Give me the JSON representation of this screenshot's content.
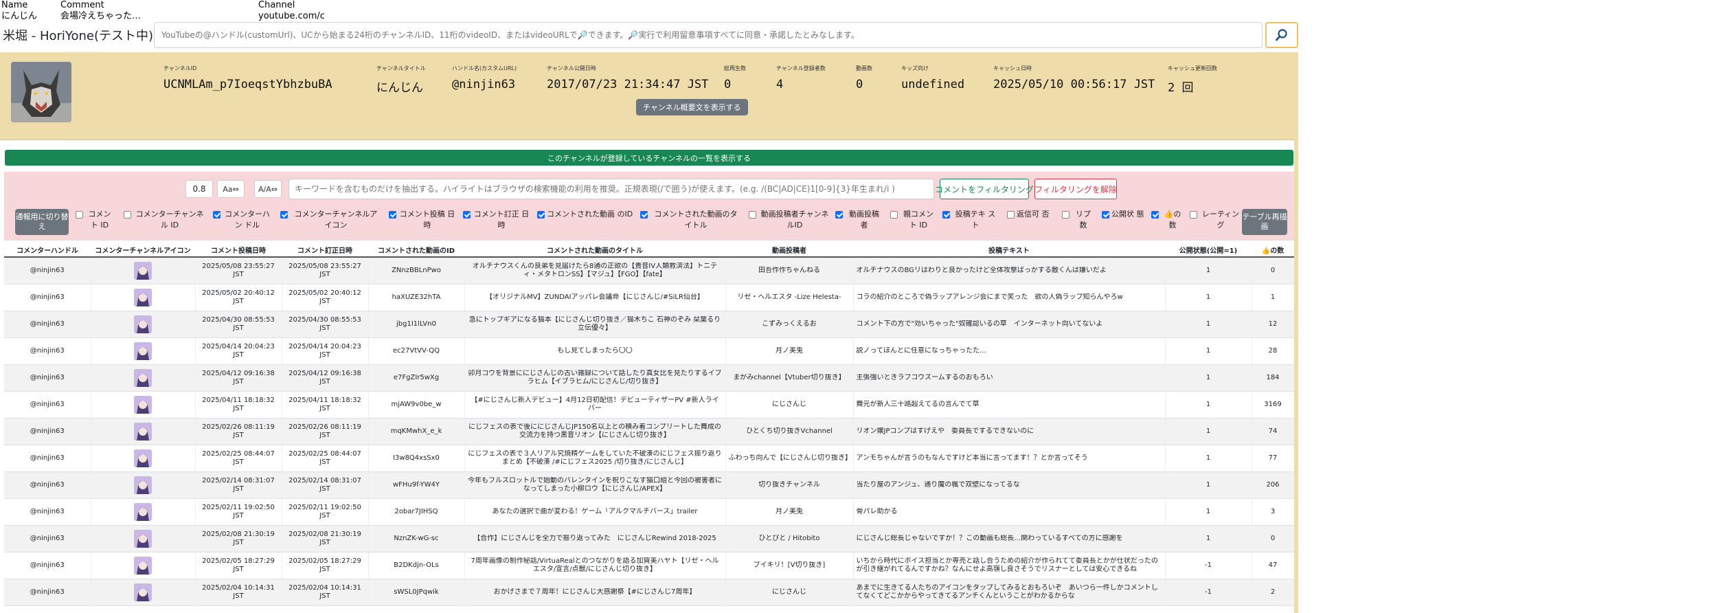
{
  "header_cols": [
    {
      "label": "Name",
      "value": "にんじん"
    },
    {
      "label": "Comment",
      "value": "会場冷えちゃった…"
    },
    {
      "label": "Channel",
      "value": "youtube.com/c"
    }
  ],
  "app_title": "米堀 - HoriYone(テスト中)",
  "search": {
    "placeholder": "YouTubeの@ハンドル(customUrl)、UCから始まる24桁のチャンネルID、11桁のvideoID、またはvideoURLで🔎できます。🔎実行で利用留意事項すべてに同意・承諾したとみなします。"
  },
  "channel": {
    "fields": [
      {
        "label": "チャンネルID",
        "value": "UCNMLAm_p7IoeqstYbhzbuBA"
      },
      {
        "label": "チャンネルタイトル",
        "value": "にんじん"
      },
      {
        "label": "ハンドル名(カスタムURL)",
        "value": "@ninjin63"
      },
      {
        "label": "チャンネル公開日時",
        "value": "2017/07/23 21:34:47 JST"
      },
      {
        "label": "総再生数",
        "value": "0"
      },
      {
        "label": "チャンネル登録者数",
        "value": "4"
      },
      {
        "label": "動画数",
        "value": "0"
      },
      {
        "label": "キッズ向け",
        "value": "undefined"
      },
      {
        "label": "キャッシュ日時",
        "value": "2025/05/10 00:56:17 JST"
      },
      {
        "label": "キャッシュ更新回数",
        "value": "2 回"
      }
    ],
    "summary_button": "チャンネル概要文を表示する"
  },
  "registered_channels_bar": "このチャンネルが登録しているチャンネルの一覧を表示する",
  "filter": {
    "threshold": "0.8",
    "btn_case": "Aa⇔",
    "btn_width": "A/A⇔",
    "placeholder": "キーワードを含むものだけを抽出する。ハイライトはブラウザの検索機能の利用を推奨。正規表現(/で囲う)が使えます。(e.g. /(BC|AD|CE)1[0-9]{3}年生まれ/i )",
    "apply_button": "コメントをフィルタリング",
    "clear_button": "フィルタリングを解除"
  },
  "toggle_button": "通報用に切り替え",
  "redraw_button": "テーブル再描画",
  "columns_checks": [
    {
      "label": "コメント ID",
      "checked": false
    },
    {
      "label": "コメンターチャンネル ID",
      "checked": false
    },
    {
      "label": "コメンターハン ドル",
      "checked": true
    },
    {
      "label": "コメンターチャンネルア イコン",
      "checked": true
    },
    {
      "label": "コメント投稿 日時",
      "checked": true
    },
    {
      "label": "コメント訂正 日時",
      "checked": true
    },
    {
      "label": "コメントされた動画 のID",
      "checked": true
    },
    {
      "label": "コメントされた動画のタ イトル",
      "checked": true
    },
    {
      "label": "動画投稿者チャンネ ルID",
      "checked": false
    },
    {
      "label": "動画投稿 者",
      "checked": true
    },
    {
      "label": "親コメント ID",
      "checked": false
    },
    {
      "label": "投稿テキ スト",
      "checked": true
    },
    {
      "label": "返信可 否",
      "checked": false
    },
    {
      "label": "リプ 数",
      "checked": false
    },
    {
      "label": "公開状 態",
      "checked": true
    },
    {
      "label": "👍の 数",
      "checked": true
    },
    {
      "label": "レーティン グ",
      "checked": false
    }
  ],
  "table": {
    "headers": [
      "コメンターハンドル",
      "コメンターチャンネルアイコン",
      "コメント投稿日時",
      "コメント訂正日時",
      "コメントされた動画のID",
      "コメントされた動画のタイトル",
      "動画投稿者",
      "投稿テキスト",
      "公開状態(公開=1)",
      "👍の数"
    ],
    "rows": [
      {
        "handle": "@ninjin63",
        "posted": "2025/05/08 23:55:27 JST",
        "edited": "2025/05/08 23:55:27 JST",
        "vid": "ZNnzBBLnPwo",
        "title": "オルチナウスくんの良弟を見届けたら8通の正欲の【貴音IV人類救済法】トニティ・メタトロンSS】【マジュ】【FGO】【fate】",
        "uploader": "田吾作作ちゃんねる",
        "text": "オルチナウスのBGリはわりと良かったけど全体攻撃ばっかする敵くんは嫌いだよ",
        "public": "1",
        "likes": "0"
      },
      {
        "handle": "@ninjin63",
        "posted": "2025/05/02 20:40:12 JST",
        "edited": "2025/05/02 20:40:12 JST",
        "vid": "haXUZE32hTA",
        "title": "【オリジナルMV】ZUNDAIアッパレ会議命【にじさんじ/#SiLR仙台】",
        "uploader": "リゼ・ヘルエスタ -Lize Helesta-",
        "text": "コラの紹介のところで偽ラップアレンジ会にまで笑った　欲の人偽ラップ知らんやろw",
        "public": "1",
        "likes": "1"
      },
      {
        "handle": "@ninjin63",
        "posted": "2025/04/30 08:55:53 JST",
        "edited": "2025/04/30 08:55:53 JST",
        "vid": "jbg1I1lLVn0",
        "title": "急にトップギアになる猫本【にじさんじ切り抜き／猫木ちこ 石神のぞみ 栞葉るり 立伝優々】",
        "uploader": "こずみっくえるお",
        "text": "コメント下の方で\"効いちゃった\"奴確認いるの草　インターネット向いてないよ",
        "public": "1",
        "likes": "12"
      },
      {
        "handle": "@ninjin63",
        "posted": "2025/04/14 20:04:23 JST",
        "edited": "2025/04/14 20:04:23 JST",
        "vid": "ec27VtVV-QQ",
        "title": "もし見てしまったら〇〇",
        "uploader": "月ノ美兎",
        "text": "説ノってほんとに任意になっちゃったた…",
        "public": "1",
        "likes": "28"
      },
      {
        "handle": "@ninjin63",
        "posted": "2025/04/12 09:16:38 JST",
        "edited": "2025/04/12 09:16:38 JST",
        "vid": "e7FgZIr5wXg",
        "title": "卯月コウを背景ににじさんじの古い雑録について話したり真女比を見たりするイブラヒム【イブラヒム/にじさんじ/切り抜き】",
        "uploader": "まがみchannel【Vtuber切り抜き】",
        "text": "主張強いときラブコウズームするのおもろい",
        "public": "1",
        "likes": "184"
      },
      {
        "handle": "@ninjin63",
        "posted": "2025/04/11 18:18:32 JST",
        "edited": "2025/04/11 18:18:32 JST",
        "vid": "mjAW9v0be_w",
        "title": "【#にじさんじ新人デビュー】4月12日初配信！デビューティザーPV #新人ライバー",
        "uploader": "にじさんじ",
        "text": "舞元が新人三十路超えてるの言んでて草",
        "public": "1",
        "likes": "3169"
      },
      {
        "handle": "@ninjin63",
        "posted": "2025/02/26 08:11:19 JST",
        "edited": "2025/02/26 08:11:19 JST",
        "vid": "mqKMwhX_e_k",
        "title": "にじフェスの表で後ににじさんじJP150名以上との積み着コンプリートした舞成の交流力を持つ黒音リオン【にじさんじ切り抜き】",
        "uploader": "ひとくち切り抜きVchannel",
        "text": "リオン嬢JPコンプはすげえや　委員長でするできないのに",
        "public": "1",
        "likes": "74"
      },
      {
        "handle": "@ninjin63",
        "posted": "2025/02/25 08:44:07 JST",
        "edited": "2025/02/25 08:44:07 JST",
        "vid": "I3w8Q4xsSx0",
        "title": "にじフェスの表で３人リアル究焼精ゲームをしていた不破湊のにじフェス振り返りまとめ【不破湊 /#にじフェス2025 /切り抜き/にじさんじ】",
        "uploader": "ふわっち向んで【にじさんじ切り抜き】",
        "text": "アンモちゃんが言うのもなんですけど本当に言ってます！？とか言ってそう",
        "public": "1",
        "likes": "77"
      },
      {
        "handle": "@ninjin63",
        "posted": "2025/02/14 08:31:07 JST",
        "edited": "2025/02/14 08:31:07 JST",
        "vid": "wFHu9f-YW4Y",
        "title": "今年もフルスロットルで始動のバレンタインを祝りこなす猫口組と今回の被害者になってしまった小柳ロウ【にじさんじ/APEX】",
        "uploader": "切り抜きチャンネル",
        "text": "当たり屋のアンジュ、通り魔の楓で双壁になってるな",
        "public": "1",
        "likes": "206"
      },
      {
        "handle": "@ninjin63",
        "posted": "2025/02/11 19:02:50 JST",
        "edited": "2025/02/11 19:02:50 JST",
        "vid": "2obar7JIHSQ",
        "title": "あなたの選択で曲が変わる！ゲーム「アルクマルチバース」trailer",
        "uploader": "月ノ美兎",
        "text": "骨パレ助かる",
        "public": "1",
        "likes": "3"
      },
      {
        "handle": "@ninjin63",
        "posted": "2025/02/08 21:30:19 JST",
        "edited": "2025/02/08 21:30:19 JST",
        "vid": "NznZK-wG-sc",
        "title": "【合作】にじさんじを全力で振り返ってみた　にじさんじRewind 2018-2025",
        "uploader": "ひとぴと / Hitobito",
        "text": "にじさんじ総長じゃないですか！？この動画も総長…関わっているすべての方に感謝を",
        "public": "1",
        "likes": "0"
      },
      {
        "handle": "@ninjin63",
        "posted": "2025/02/05 18:27:29 JST",
        "edited": "2025/02/05 18:27:29 JST",
        "vid": "B2DKdjn-OLs",
        "title": "7周年画像の制作秘話/VirtuaRealとのつながりを語る加賀美ハヤト【リゼ・ヘルエスタ/宣言/点獣/にじさんじ切り抜き】",
        "uploader": "ブイキリ！[V切り抜き]",
        "text": "いちから時代にボイス担当とか専売と話し合うための紹介が作られてて委員長とかが仕状だったのが引き継がれてるんですかね？なんにせよ高嶺し良さそうでリスナーとしては安心できるね",
        "public": "-1",
        "likes": "47"
      },
      {
        "handle": "@ninjin63",
        "posted": "2025/02/04 10:14:31 JST",
        "edited": "2025/02/04 10:14:31 JST",
        "vid": "sWSL0JPqwik",
        "title": "おかげさまで７周年！にじさんじ大感謝祭【#にじさんじ7周年】",
        "uploader": "にじさんじ",
        "text": "あまでに生きてる人たちのアイコンをタップしてみるとおもろいぞ　あいつら一件しかコメントしてなくてどこかからやってきてるアンチくんということがわかるからな",
        "public": "-1",
        "likes": "2"
      }
    ]
  },
  "colors": {
    "channel_bg": "#eedcaa",
    "green_bar": "#198754",
    "filter_bg": "#f8d7da",
    "secondary_btn": "#6c757d",
    "check_on": "#0d6efd"
  }
}
